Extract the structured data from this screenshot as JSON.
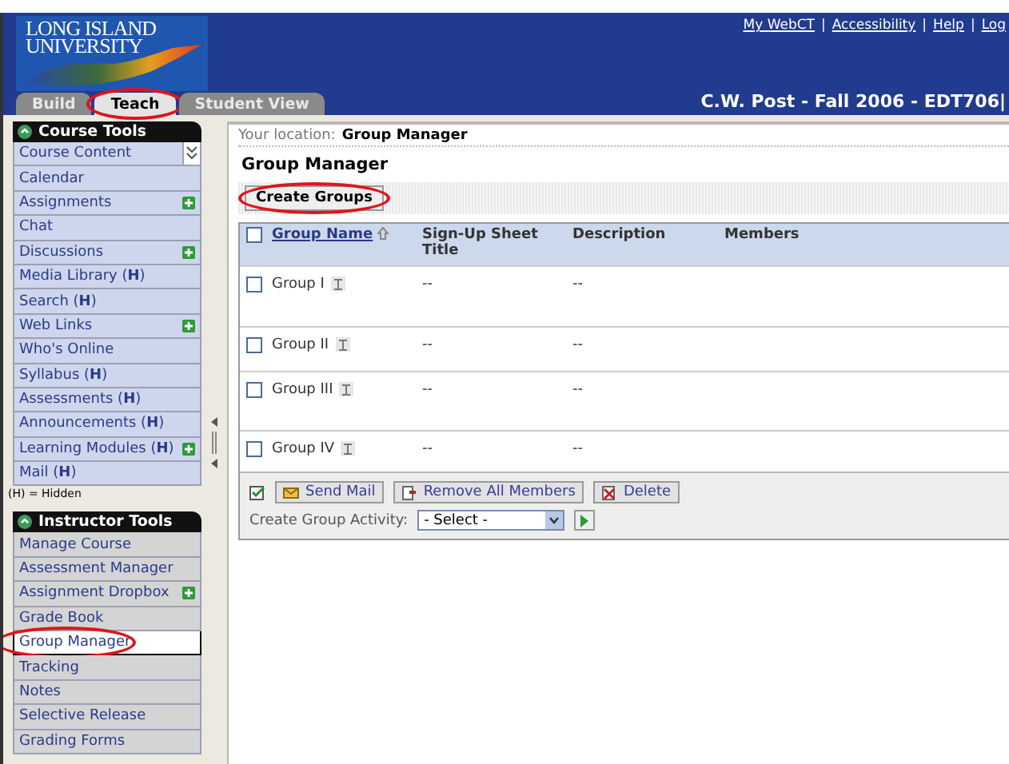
{
  "header": {
    "logo_lines": [
      "LONG ISLAND",
      "UNIVERSITY"
    ],
    "links": [
      {
        "kind": "link",
        "text": "My WebCT"
      },
      {
        "kind": "separator",
        "text": "|"
      },
      {
        "kind": "link",
        "text": "Accessibility"
      },
      {
        "kind": "separator",
        "text": "|"
      },
      {
        "kind": "link",
        "text": "Help"
      },
      {
        "kind": "separator",
        "text": "|"
      },
      {
        "kind": "link",
        "text": "Log"
      }
    ],
    "course_title": "C.W. Post - Fall 2006 - EDT706|"
  },
  "tabs": [
    {
      "label": "Build",
      "selected": false,
      "circled": false
    },
    {
      "label": "Teach",
      "selected": true,
      "circled": true
    },
    {
      "label": "Student View",
      "selected": false,
      "circled": false
    }
  ],
  "course_tools": {
    "title": "Course Tools",
    "items": [
      {
        "label": "Course Content",
        "kind": "expander",
        "add_icon": false,
        "selected": false
      },
      {
        "label": "Calendar",
        "kind": "link",
        "add_icon": false,
        "selected": false
      },
      {
        "label": "Assignments",
        "kind": "link",
        "add_icon": true,
        "selected": false
      },
      {
        "label": "Chat",
        "kind": "link",
        "add_icon": false,
        "selected": false
      },
      {
        "label": "Discussions",
        "kind": "link",
        "add_icon": true,
        "selected": false
      },
      {
        "label": "Media Library (**H**)",
        "kind": "link",
        "add_icon": false,
        "selected": false
      },
      {
        "label": "Search (**H**)",
        "kind": "link",
        "add_icon": false,
        "selected": false
      },
      {
        "label": "Web Links",
        "kind": "link",
        "add_icon": true,
        "selected": false
      },
      {
        "label": "Who's Online",
        "kind": "link",
        "add_icon": false,
        "selected": false
      },
      {
        "label": "Syllabus (**H**)",
        "kind": "link",
        "add_icon": false,
        "selected": false
      },
      {
        "label": "Assessments (**H**)",
        "kind": "link",
        "add_icon": false,
        "selected": false
      },
      {
        "label": "Announcements (**H**)",
        "kind": "link",
        "add_icon": false,
        "selected": false
      },
      {
        "label": "Learning Modules (**H**)",
        "kind": "link",
        "add_icon": true,
        "selected": false
      },
      {
        "label": "Mail (**H**)",
        "kind": "link",
        "add_icon": false,
        "selected": false
      }
    ],
    "legend": "(H) = Hidden"
  },
  "instructor_tools": {
    "title": "Instructor Tools",
    "items": [
      {
        "label": "Manage Course",
        "add_icon": false,
        "selected": false,
        "circled": false
      },
      {
        "label": "Assessment Manager",
        "add_icon": false,
        "selected": false,
        "circled": false
      },
      {
        "label": "Assignment Dropbox",
        "add_icon": true,
        "selected": false,
        "circled": false
      },
      {
        "label": "Grade Book",
        "add_icon": false,
        "selected": false,
        "circled": false
      },
      {
        "label": "Group Manager",
        "add_icon": false,
        "selected": true,
        "circled": true
      },
      {
        "label": "Tracking",
        "add_icon": false,
        "selected": false,
        "circled": false
      },
      {
        "label": "Notes",
        "add_icon": false,
        "selected": false,
        "circled": false
      },
      {
        "label": "Selective Release",
        "add_icon": false,
        "selected": false,
        "circled": false
      },
      {
        "label": "Grading Forms",
        "add_icon": false,
        "selected": false,
        "circled": false
      }
    ]
  },
  "location": {
    "prefix": "Your location:",
    "current": "Group Manager"
  },
  "page_title": "Group Manager",
  "create_button": {
    "label": "Create Groups",
    "circled": true
  },
  "table": {
    "select_all": {
      "checked": false
    },
    "columns": [
      {
        "label": "Group Name",
        "sortable": true
      },
      {
        "label": "Sign-Up Sheet Title",
        "sortable": false
      },
      {
        "label": "Description",
        "sortable": false
      },
      {
        "label": "Members",
        "sortable": false
      }
    ],
    "rows": [
      {
        "name": "Group I",
        "signup": "--",
        "description": "--",
        "checked": false
      },
      {
        "name": "Group II",
        "signup": "--",
        "description": "--",
        "checked": false
      },
      {
        "name": "Group III",
        "signup": "--",
        "description": "--",
        "checked": false
      },
      {
        "name": "Group IV",
        "signup": "--",
        "description": "--",
        "checked": false
      }
    ]
  },
  "actions": [
    "Send Mail",
    "Remove All Members",
    "Delete"
  ],
  "activity": {
    "label": "Create Group Activity:",
    "value": "- Select -"
  }
}
